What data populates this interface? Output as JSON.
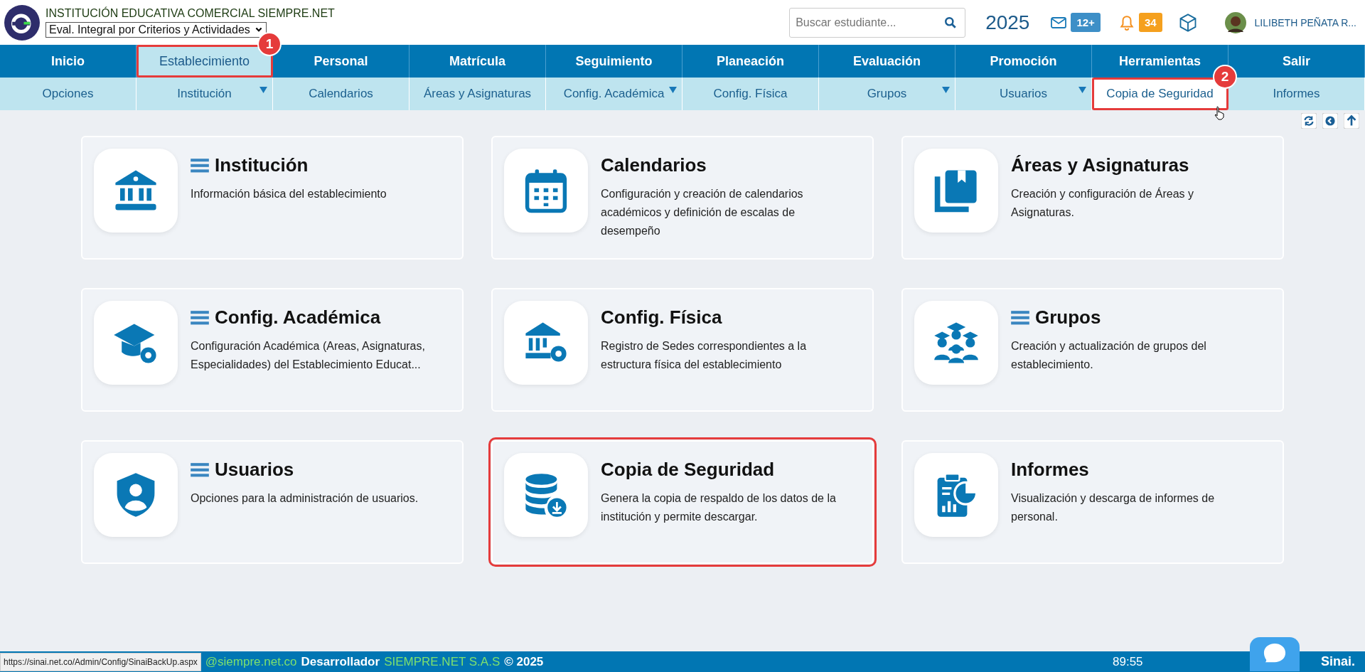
{
  "header": {
    "school_name": "INSTITUCIÓN EDUCATIVA COMERCIAL SIEMPRE.NET",
    "evaluation_select": "Eval. Integral por Criterios y Actividades",
    "search": {
      "placeholder": "Buscar estudiante..."
    },
    "year": "2025",
    "messages_badge": "12+",
    "notifications_badge": "34",
    "user_name": "LILIBETH PEÑATA R..."
  },
  "main_nav": [
    {
      "label": "Inicio",
      "selected": false
    },
    {
      "label": "Establecimiento",
      "selected": true,
      "callout": "1"
    },
    {
      "label": "Personal",
      "selected": false
    },
    {
      "label": "Matrícula",
      "selected": false
    },
    {
      "label": "Seguimiento",
      "selected": false
    },
    {
      "label": "Planeación",
      "selected": false
    },
    {
      "label": "Evaluación",
      "selected": false
    },
    {
      "label": "Promoción",
      "selected": false
    },
    {
      "label": "Herramientas",
      "selected": false
    },
    {
      "label": "Salir",
      "selected": false
    }
  ],
  "sub_nav": [
    {
      "label": "Opciones",
      "selected": false,
      "dropdown": false
    },
    {
      "label": "Institución",
      "selected": false,
      "dropdown": true
    },
    {
      "label": "Calendarios",
      "selected": false,
      "dropdown": false
    },
    {
      "label": "Áreas y Asignaturas",
      "selected": false,
      "dropdown": false
    },
    {
      "label": "Config. Académica",
      "selected": false,
      "dropdown": true
    },
    {
      "label": "Config. Física",
      "selected": false,
      "dropdown": false
    },
    {
      "label": "Grupos",
      "selected": false,
      "dropdown": true
    },
    {
      "label": "Usuarios",
      "selected": false,
      "dropdown": true
    },
    {
      "label": "Copia de Seguridad",
      "selected": true,
      "dropdown": false,
      "callout": "2"
    },
    {
      "label": "Informes",
      "selected": false,
      "dropdown": false
    }
  ],
  "cards": [
    {
      "kind": "bank",
      "title": "Institución",
      "menu": true,
      "description": "Información básica del establecimiento",
      "outlined": false
    },
    {
      "kind": "calendar",
      "title": "Calendarios",
      "menu": false,
      "description": "Configuración y creación de calendarios académicos y definición de escalas de desempeño",
      "outlined": false
    },
    {
      "kind": "book",
      "title": "Áreas y Asignaturas",
      "menu": false,
      "description": "Creación y configuración de Áreas y Asignaturas.",
      "outlined": false
    },
    {
      "kind": "cap",
      "title": "Config. Académica",
      "menu": true,
      "description": "Configuración Académica (Areas, Asignaturas, Especialidades) del Establecimiento Educat...",
      "outlined": false
    },
    {
      "kind": "building",
      "title": "Config. Física",
      "menu": false,
      "description": "Registro de Sedes correspondientes a la estructura física del establecimiento",
      "outlined": false
    },
    {
      "kind": "group",
      "title": "Grupos",
      "menu": true,
      "description": "Creación y actualización de grupos del establecimiento.",
      "outlined": false
    },
    {
      "kind": "shield",
      "title": "Usuarios",
      "menu": true,
      "description": "Opciones para la administración de usuarios.",
      "outlined": false
    },
    {
      "kind": "database",
      "title": "Copia de Seguridad",
      "menu": false,
      "description": "Genera la copia de respaldo de los datos de la institución y permite descargar.",
      "outlined": true
    },
    {
      "kind": "report",
      "title": "Informes",
      "menu": false,
      "description": "Visualización y descarga de informes de personal.",
      "outlined": false
    }
  ],
  "footer": {
    "status_url": "https://sinai.net.co/Admin/Config/SinaiBackUp.aspx",
    "email_fragment": "@siempre.net.co",
    "developer_label": "Desarrollador",
    "developer_name": "SIEMPRE.NET S.A.S",
    "copyright": "© 2025",
    "timer": "89:55",
    "brand": "Sinai."
  }
}
